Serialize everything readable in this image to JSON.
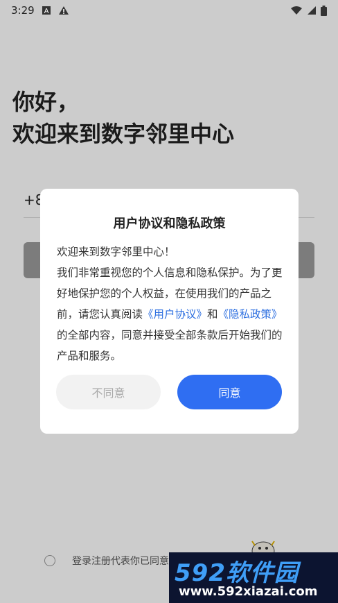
{
  "status_bar": {
    "time": "3:29",
    "icons": [
      "a-box-icon",
      "warning-icon",
      "wifi-icon",
      "signal-icon",
      "battery-icon"
    ]
  },
  "greeting": {
    "line1": "你好，",
    "line2": "欢迎来到数字邻里中心"
  },
  "login": {
    "phone_prefix": "+8"
  },
  "agreement_row": {
    "text": "登录注册代表你已同意"
  },
  "dialog": {
    "title": "用户协议和隐私政策",
    "body_welcome": "欢迎来到数字邻里中心！",
    "body_text1": "我们非常重视您的个人信息和隐私保护。为了更好地保护您的个人权益，在使用我们的产品之前，请您认真阅读",
    "link_user_agreement": "《用户协议》",
    "body_and": "和",
    "link_privacy_policy": "《隐私政策》",
    "body_text2": "的全部内容，同意并接受全部条款后开始我们的产品和服务。",
    "disagree_label": "不同意",
    "agree_label": "同意"
  },
  "watermark": {
    "brand": "592软件园",
    "url": "www.592xiazai.com"
  },
  "colors": {
    "primary": "#2f6ef2",
    "link": "#2d6fe0",
    "overlay": "rgba(0,0,0,0.2)"
  }
}
